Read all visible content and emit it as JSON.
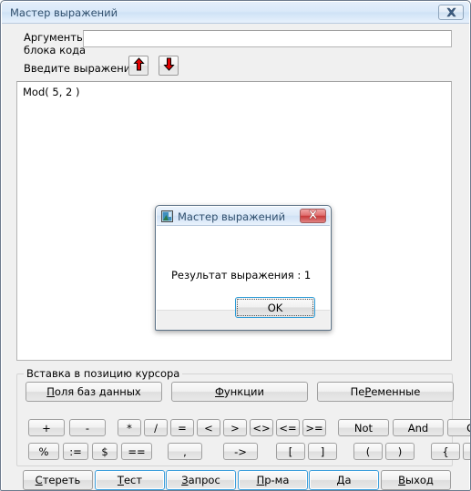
{
  "window": {
    "title": "Мастер выражений",
    "close_icon": "close-x-icon"
  },
  "form": {
    "args_label_line1": "Аргументы",
    "args_label_line2": "блока кода",
    "args_value": "",
    "args_placeholder": "",
    "expr_label": "Введите выражение:",
    "arrow_up_icon": "arrow-up-icon",
    "arrow_down_icon": "arrow-down-icon",
    "expression_value": "Mod( 5, 2 )"
  },
  "insert_group": {
    "title": "Вставка в позицию курсора",
    "wide_buttons": [
      {
        "label": "Поля баз данных",
        "accel_index": 0
      },
      {
        "label": "Функции",
        "accel_index": 0
      },
      {
        "label": "ПеРеменные",
        "accel_index": 2
      }
    ],
    "row1": [
      "+",
      "-",
      "*",
      "/",
      "=",
      "<",
      ">",
      "<>",
      "<=",
      ">=",
      "Not",
      "And",
      "Or"
    ],
    "row2": [
      "%",
      ":=",
      "$",
      "==",
      ",",
      "->",
      "[",
      "]",
      "(",
      ")",
      "{",
      "}"
    ]
  },
  "action_bar": {
    "buttons": [
      {
        "label": "Стереть",
        "accel_index": 0,
        "focused": false
      },
      {
        "label": "Тест",
        "accel_index": 0,
        "focused": true
      },
      {
        "label": "Запрос",
        "accel_index": 0,
        "focused": true
      },
      {
        "label": "Пр-ма",
        "accel_index": 0,
        "focused": true
      },
      {
        "label": "Да",
        "accel_index": 0,
        "focused": true
      },
      {
        "label": "Выход",
        "accel_index": 0,
        "focused": false
      }
    ]
  },
  "modal": {
    "title": "Мастер выражений",
    "app_icon": "app-window-icon",
    "close_icon": "close-x-icon",
    "message": "Результат выражения : 1",
    "ok_label": "OK"
  },
  "colors": {
    "window_bg": "#f0f0f0",
    "titlebar": "#dae9f9",
    "title_text": "#31506e",
    "field_bg": "#ffffff",
    "focus_blue": "#3c9fdc",
    "close_red": "#c83a3a",
    "arrow_red": "#e00000"
  }
}
